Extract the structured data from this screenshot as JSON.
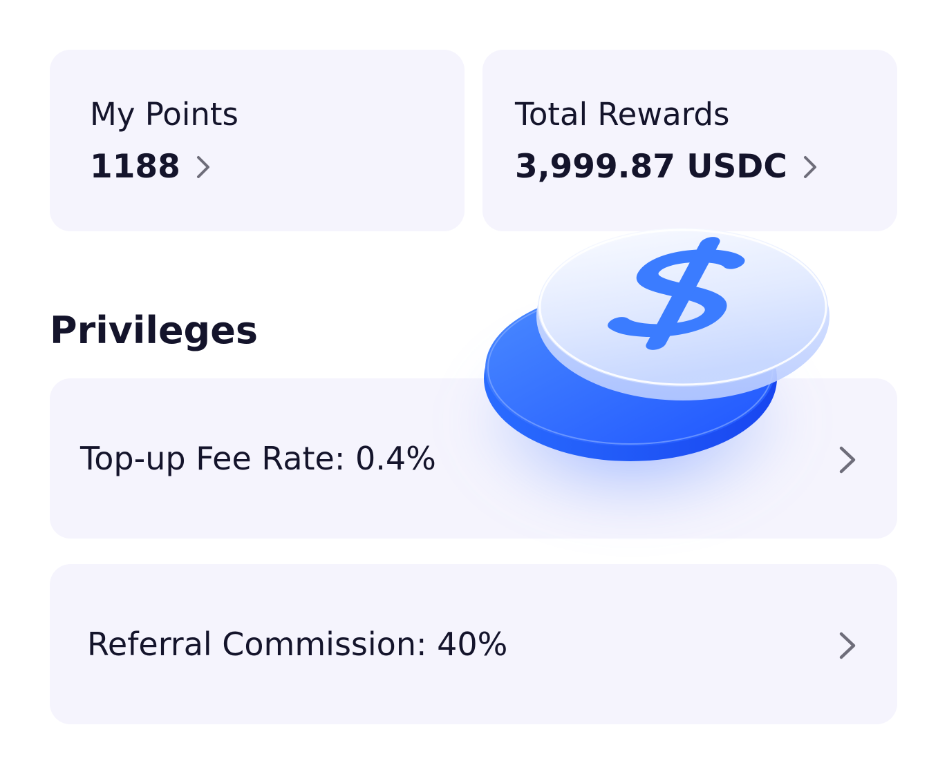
{
  "points": {
    "label": "My Points",
    "value": "1188",
    "chevron_icon": "chevron-right-icon"
  },
  "rewards": {
    "label": "Total Rewards",
    "value": "3,999.87 USDC",
    "chevron_icon": "chevron-right-icon"
  },
  "privileges": {
    "title": "Privileges",
    "items": [
      {
        "label": "Top-up Fee Rate: 0.4%",
        "icon": "chevron-right-icon"
      },
      {
        "label": "Referral Commission: 40%",
        "icon": "chevron-right-icon"
      }
    ]
  },
  "illustration": {
    "icon": "dollar-coins-icon"
  },
  "colors": {
    "card_background": "#f5f4fd",
    "text_primary": "#14142b",
    "chevron": "#6e6d7a",
    "accent_blue": "#2f6bff"
  }
}
